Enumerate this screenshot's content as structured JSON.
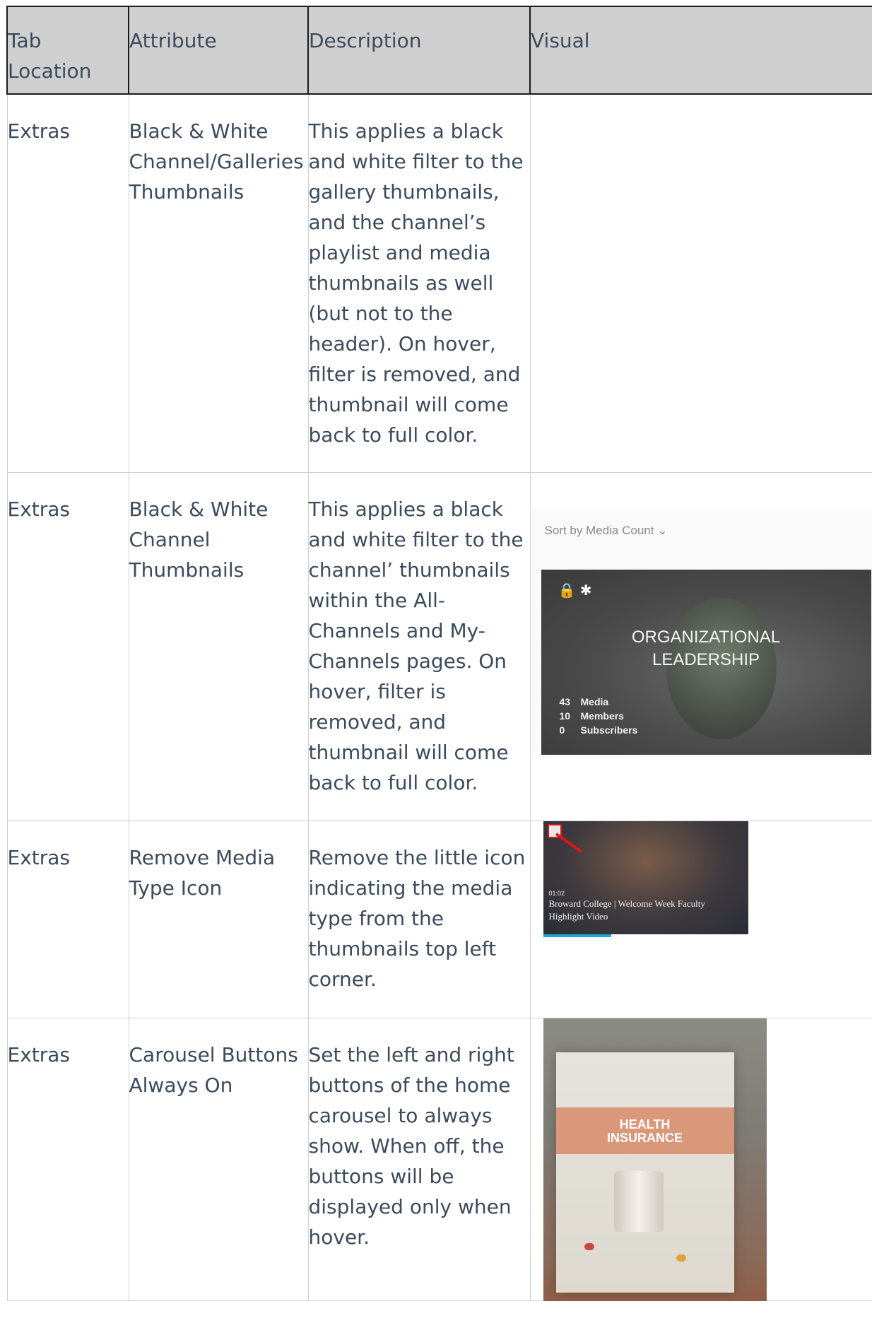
{
  "headers": [
    "Tab Location",
    "Attribute",
    "Description",
    "Visual"
  ],
  "rows": [
    {
      "tab": "Extras",
      "attribute": "Black & White Channel/Galleries Thumbnails",
      "description": "This applies a black and white filter to the gallery thumbnails, and the channel’s playlist and media thumbnails as well (but not to the header). On hover, filter is removed, and thumbnail will come back to full color."
    },
    {
      "tab": "Extras",
      "attribute": "Black & White Channel Thumbnails",
      "description": "This applies a black and white filter to the channel’ thumbnails within the All-Channels and My-Channels pages. On hover, filter is removed, and thumbnail will come back to full color.",
      "visual": {
        "sort_label": "Sort by Media Count ⌄",
        "title_line1": "ORGANIZATIONAL",
        "title_line2": "LEADERSHIP",
        "stats": [
          {
            "count": "43",
            "label": "Media"
          },
          {
            "count": "10",
            "label": "Members"
          },
          {
            "count": "0",
            "label": "Subscribers"
          }
        ]
      }
    },
    {
      "tab": "Extras",
      "attribute": "Remove Media Type Icon",
      "description": "Remove the little icon indicating the media type from the thumbnails top left corner.",
      "visual": {
        "duration": "01:02",
        "caption": "Broward College | Welcome Week Faculty Highlight Video"
      }
    },
    {
      "tab": "Extras",
      "attribute": "Carousel Buttons Always On",
      "description": "Set the left and right buttons of the home carousel to always show. When off, the buttons will be displayed only when hover.",
      "visual": {
        "banner_line1": "HEALTH",
        "banner_line2": "INSURANCE"
      }
    }
  ]
}
